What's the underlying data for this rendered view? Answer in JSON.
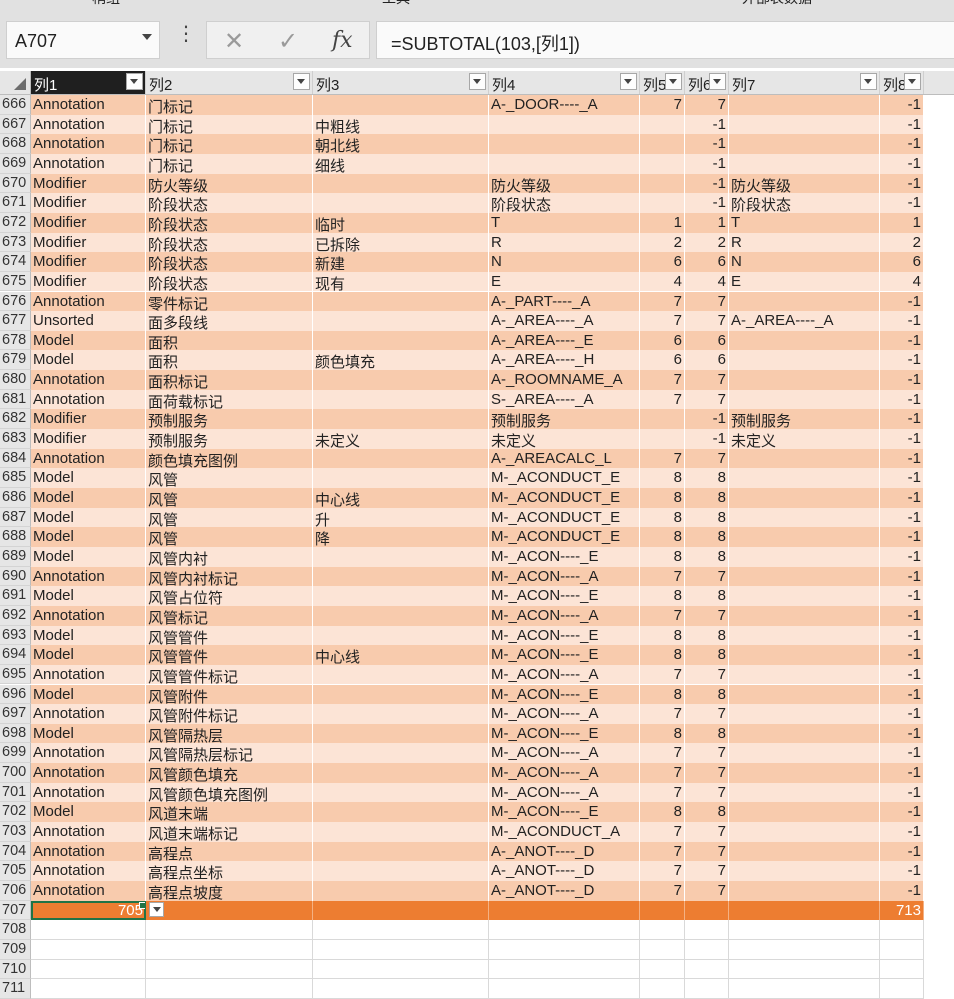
{
  "ribbon": {
    "top_partial_labels": [
      "稍组",
      "工具",
      "外部表数据"
    ]
  },
  "name_box": "A707",
  "formula_bar": {
    "fx_label": "fx",
    "cancel_symbol": "✕",
    "enter_symbol": "✓",
    "formula": "=SUBTOTAL(103,[列1])"
  },
  "columns": [
    {
      "label": "列1"
    },
    {
      "label": "列2"
    },
    {
      "label": "列3"
    },
    {
      "label": "列4"
    },
    {
      "label": "列5"
    },
    {
      "label": "列6"
    },
    {
      "label": "列7"
    },
    {
      "label": "列8"
    }
  ],
  "rows": [
    {
      "n": "666",
      "c": [
        "Annotation",
        "门标记",
        "",
        "A-_DOOR----_A",
        "7",
        "7",
        "",
        "-1"
      ]
    },
    {
      "n": "667",
      "c": [
        "Annotation",
        "门标记",
        "中粗线",
        "",
        "",
        "-1",
        "",
        "-1"
      ]
    },
    {
      "n": "668",
      "c": [
        "Annotation",
        "门标记",
        "朝北线",
        "",
        "",
        "-1",
        "",
        "-1"
      ]
    },
    {
      "n": "669",
      "c": [
        "Annotation",
        "门标记",
        "细线",
        "",
        "",
        "-1",
        "",
        "-1"
      ]
    },
    {
      "n": "670",
      "c": [
        "Modifier",
        "防火等级",
        "",
        "防火等级",
        "",
        "-1",
        "防火等级",
        "-1"
      ]
    },
    {
      "n": "671",
      "c": [
        "Modifier",
        "阶段状态",
        "",
        "阶段状态",
        "",
        "-1",
        "阶段状态",
        "-1"
      ]
    },
    {
      "n": "672",
      "c": [
        "Modifier",
        "阶段状态",
        "临时",
        "T",
        "1",
        "1",
        "T",
        "1"
      ]
    },
    {
      "n": "673",
      "c": [
        "Modifier",
        "阶段状态",
        "已拆除",
        "R",
        "2",
        "2",
        "R",
        "2"
      ]
    },
    {
      "n": "674",
      "c": [
        "Modifier",
        "阶段状态",
        "新建",
        "N",
        "6",
        "6",
        "N",
        "6"
      ]
    },
    {
      "n": "675",
      "c": [
        "Modifier",
        "阶段状态",
        "现有",
        "E",
        "4",
        "4",
        "E",
        "4"
      ]
    },
    {
      "n": "676",
      "c": [
        "Annotation",
        "零件标记",
        "",
        "A-_PART----_A",
        "7",
        "7",
        "",
        "-1"
      ]
    },
    {
      "n": "677",
      "c": [
        "Unsorted",
        "面多段线",
        "",
        "A-_AREA----_A",
        "7",
        "7",
        "A-_AREA----_A",
        "-1"
      ]
    },
    {
      "n": "678",
      "c": [
        "Model",
        "面积",
        "",
        "A-_AREA----_E",
        "6",
        "6",
        "",
        "-1"
      ]
    },
    {
      "n": "679",
      "c": [
        "Model",
        "面积",
        "颜色填充",
        "A-_AREA----_H",
        "6",
        "6",
        "",
        "-1"
      ]
    },
    {
      "n": "680",
      "c": [
        "Annotation",
        "面积标记",
        "",
        "A-_ROOMNAME_A",
        "7",
        "7",
        "",
        "-1"
      ]
    },
    {
      "n": "681",
      "c": [
        "Annotation",
        "面荷载标记",
        "",
        "S-_AREA----_A",
        "7",
        "7",
        "",
        "-1"
      ]
    },
    {
      "n": "682",
      "c": [
        "Modifier",
        "预制服务",
        "",
        "预制服务",
        "",
        "-1",
        "预制服务",
        "-1"
      ]
    },
    {
      "n": "683",
      "c": [
        "Modifier",
        "预制服务",
        "未定义",
        "未定义",
        "",
        "-1",
        "未定义",
        "-1"
      ]
    },
    {
      "n": "684",
      "c": [
        "Annotation",
        "颜色填充图例",
        "",
        "A-_AREACALC_L",
        "7",
        "7",
        "",
        "-1"
      ]
    },
    {
      "n": "685",
      "c": [
        "Model",
        "风管",
        "",
        "M-_ACONDUCT_E",
        "8",
        "8",
        "",
        "-1"
      ]
    },
    {
      "n": "686",
      "c": [
        "Model",
        "风管",
        "中心线",
        "M-_ACONDUCT_E",
        "8",
        "8",
        "",
        "-1"
      ]
    },
    {
      "n": "687",
      "c": [
        "Model",
        "风管",
        "升",
        "M-_ACONDUCT_E",
        "8",
        "8",
        "",
        "-1"
      ]
    },
    {
      "n": "688",
      "c": [
        "Model",
        "风管",
        "降",
        "M-_ACONDUCT_E",
        "8",
        "8",
        "",
        "-1"
      ]
    },
    {
      "n": "689",
      "c": [
        "Model",
        "风管内衬",
        "",
        "M-_ACON----_E",
        "8",
        "8",
        "",
        "-1"
      ]
    },
    {
      "n": "690",
      "c": [
        "Annotation",
        "风管内衬标记",
        "",
        "M-_ACON----_A",
        "7",
        "7",
        "",
        "-1"
      ]
    },
    {
      "n": "691",
      "c": [
        "Model",
        "风管占位符",
        "",
        "M-_ACON----_E",
        "8",
        "8",
        "",
        "-1"
      ]
    },
    {
      "n": "692",
      "c": [
        "Annotation",
        "风管标记",
        "",
        "M-_ACON----_A",
        "7",
        "7",
        "",
        "-1"
      ]
    },
    {
      "n": "693",
      "c": [
        "Model",
        "风管管件",
        "",
        "M-_ACON----_E",
        "8",
        "8",
        "",
        "-1"
      ]
    },
    {
      "n": "694",
      "c": [
        "Model",
        "风管管件",
        "中心线",
        "M-_ACON----_E",
        "8",
        "8",
        "",
        "-1"
      ]
    },
    {
      "n": "695",
      "c": [
        "Annotation",
        "风管管件标记",
        "",
        "M-_ACON----_A",
        "7",
        "7",
        "",
        "-1"
      ]
    },
    {
      "n": "696",
      "c": [
        "Model",
        "风管附件",
        "",
        "M-_ACON----_E",
        "8",
        "8",
        "",
        "-1"
      ]
    },
    {
      "n": "697",
      "c": [
        "Annotation",
        "风管附件标记",
        "",
        "M-_ACON----_A",
        "7",
        "7",
        "",
        "-1"
      ]
    },
    {
      "n": "698",
      "c": [
        "Model",
        "风管隔热层",
        "",
        "M-_ACON----_E",
        "8",
        "8",
        "",
        "-1"
      ]
    },
    {
      "n": "699",
      "c": [
        "Annotation",
        "风管隔热层标记",
        "",
        "M-_ACON----_A",
        "7",
        "7",
        "",
        "-1"
      ]
    },
    {
      "n": "700",
      "c": [
        "Annotation",
        "风管颜色填充",
        "",
        "M-_ACON----_A",
        "7",
        "7",
        "",
        "-1"
      ]
    },
    {
      "n": "701",
      "c": [
        "Annotation",
        "风管颜色填充图例",
        "",
        "M-_ACON----_A",
        "7",
        "7",
        "",
        "-1"
      ]
    },
    {
      "n": "702",
      "c": [
        "Model",
        "风道末端",
        "",
        "M-_ACON----_E",
        "8",
        "8",
        "",
        "-1"
      ]
    },
    {
      "n": "703",
      "c": [
        "Annotation",
        "风道末端标记",
        "",
        "M-_ACONDUCT_A",
        "7",
        "7",
        "",
        "-1"
      ]
    },
    {
      "n": "704",
      "c": [
        "Annotation",
        "高程点",
        "",
        "A-_ANOT----_D",
        "7",
        "7",
        "",
        "-1"
      ]
    },
    {
      "n": "705",
      "c": [
        "Annotation",
        "高程点坐标",
        "",
        "A-_ANOT----_D",
        "7",
        "7",
        "",
        "-1"
      ]
    },
    {
      "n": "706",
      "c": [
        "Annotation",
        "高程点坡度",
        "",
        "A-_ANOT----_D",
        "7",
        "7",
        "",
        "-1"
      ]
    }
  ],
  "total_row": {
    "n": "707",
    "c": [
      "705",
      "",
      "",
      "",
      "",
      "",
      "",
      "713"
    ]
  },
  "empty_rows": [
    "708",
    "709",
    "710",
    "711"
  ]
}
